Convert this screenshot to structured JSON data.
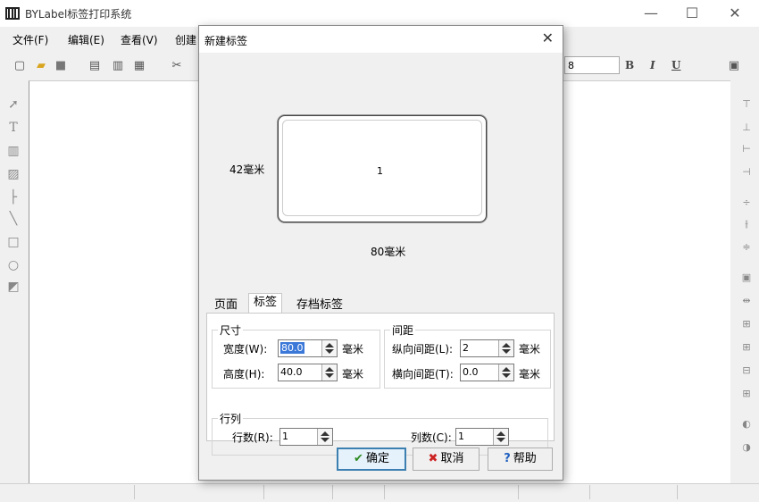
{
  "app": {
    "title": "BYLabel标签打印系统",
    "icon": "barcode-app-icon"
  },
  "window_controls": {
    "minimize": "—",
    "maximize": "☐",
    "close": "✕"
  },
  "menu": [
    {
      "label": "文件(F)"
    },
    {
      "label": "编辑(E)"
    },
    {
      "label": "查看(V)"
    },
    {
      "label": "创建"
    }
  ],
  "toolbar": {
    "font_size": "8",
    "bold": "B",
    "italic": "I",
    "underline": "U"
  },
  "dialog": {
    "title": "新建标签",
    "close": "✕",
    "preview": {
      "label_number": "1",
      "height_text": "42毫米",
      "width_text": "80毫米"
    },
    "tabs": [
      {
        "label": "页面"
      },
      {
        "label": "标签",
        "active": true
      },
      {
        "label": "存档标签"
      }
    ],
    "size_group": {
      "title": "尺寸",
      "width_label": "宽度(W):",
      "width_value": "80.0",
      "height_label": "高度(H):",
      "height_value": "40.0",
      "unit": "毫米"
    },
    "gap_group": {
      "title": "间距",
      "vgap_label": "纵向间距(L):",
      "vgap_value": "2",
      "hgap_label": "横向间距(T):",
      "hgap_value": "0.0",
      "unit": "毫米"
    },
    "rowcol_group": {
      "title": "行列",
      "rows_label": "行数(R):",
      "rows_value": "1",
      "cols_label": "列数(C):",
      "cols_value": "1"
    },
    "buttons": {
      "ok": "确定",
      "cancel": "取消",
      "help": "帮助"
    }
  },
  "colors": {
    "accent": "#3c7fb1",
    "selection": "#3b78d8",
    "ok_check": "#2e8b22",
    "cancel_x": "#cc2222",
    "help_q": "#1f5fbf"
  }
}
